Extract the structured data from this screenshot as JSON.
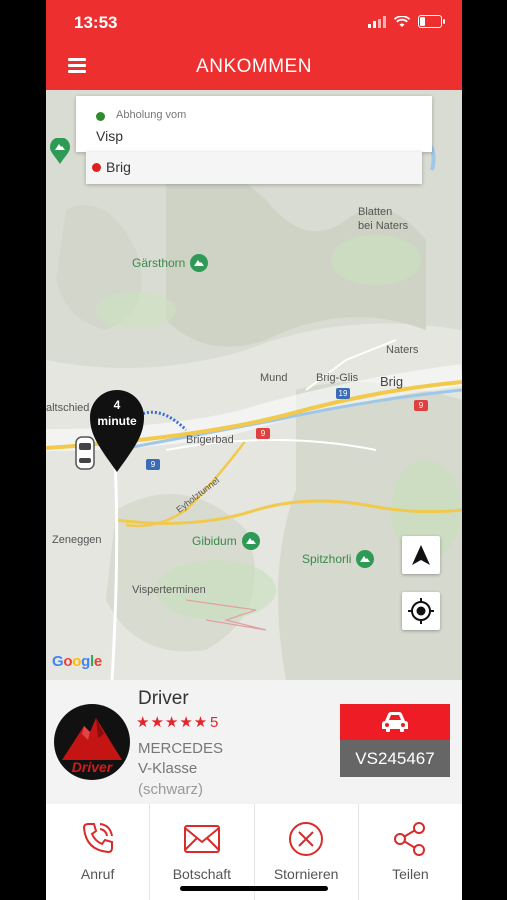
{
  "status_bar": {
    "time": "13:53"
  },
  "header": {
    "title": "ANKOMMEN"
  },
  "trip": {
    "pickup_caption": "Abholung vom",
    "pickup": "Visp",
    "destination": "Brig"
  },
  "map": {
    "places": [
      "Blatten",
      "bei Naters",
      "Naters",
      "Mund",
      "Brig-Glis",
      "Brig",
      "Brigerbad",
      "Zeneggen",
      "Visperterminen",
      "altschied",
      "Eyholztunnel"
    ],
    "pois": [
      "Gärsthorn",
      "Gibidum",
      "Spitzhorli"
    ],
    "road_numbers": [
      "9",
      "19"
    ],
    "eta_value": "4",
    "eta_unit": "minute",
    "attribution": "Google"
  },
  "driver": {
    "name": "Driver",
    "stars": "★★★★★",
    "rating": "5",
    "car_make": "MERCEDES",
    "car_model": "V-Klasse",
    "car_color": "(schwarz)",
    "plate": "VS245467",
    "avatar_text": "Driver"
  },
  "actions": [
    {
      "label": "Anruf",
      "icon": "phone-icon"
    },
    {
      "label": "Botschaft",
      "icon": "mail-icon"
    },
    {
      "label": "Stornieren",
      "icon": "cancel-icon"
    },
    {
      "label": "Teilen",
      "icon": "share-icon"
    }
  ],
  "colors": {
    "brand": "#ee2f2f",
    "star": "#e4252b",
    "plate_bg": "#666666",
    "pickup_dot": "#2e8b2e",
    "destination_dot": "#e02020"
  }
}
